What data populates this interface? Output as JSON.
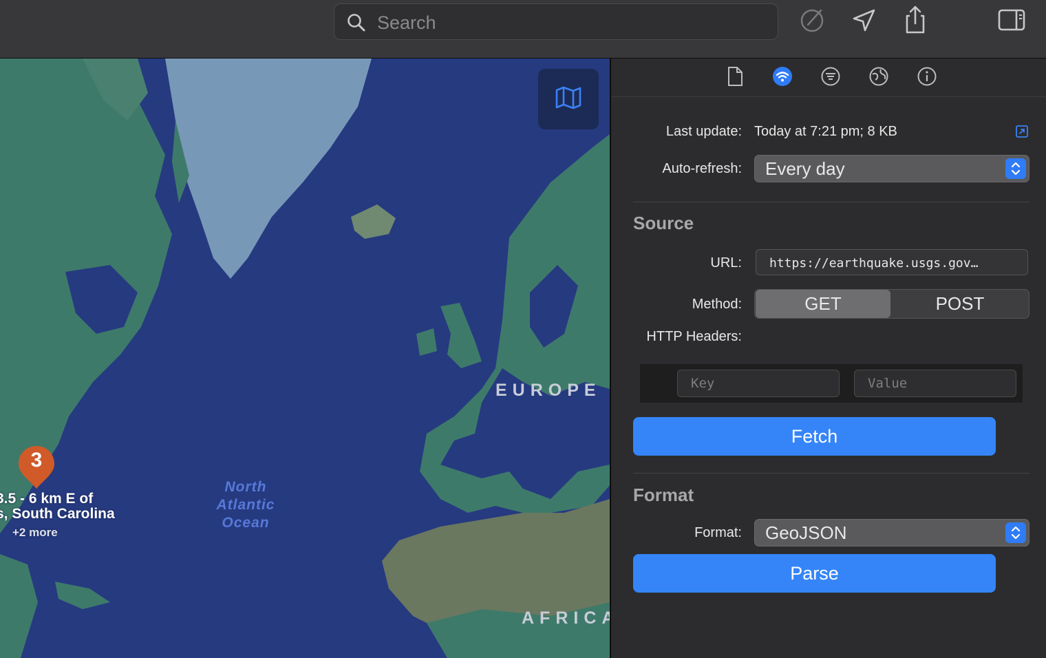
{
  "search": {
    "placeholder": "Search"
  },
  "toolbar": {
    "icons": [
      "check-circle-icon",
      "location-arrow-icon",
      "share-icon",
      "sidebar-icon"
    ]
  },
  "map": {
    "labels": {
      "europe": "EUROPE",
      "africa": "AFRICA"
    },
    "ocean": {
      "line1": "North",
      "line2": "Atlantic",
      "line3": "Ocean"
    },
    "cluster": {
      "count": "3",
      "title_line1": "3.5 - 6 km E of",
      "title_line2": "s, South Carolina",
      "more": "+2 more"
    }
  },
  "inspector": {
    "tabs": [
      "document-icon",
      "feed-icon",
      "filter-icon",
      "globe-icon",
      "info-icon"
    ],
    "active_tab": "feed-icon",
    "last_update_label": "Last update:",
    "last_update_value": "Today at 7:21 pm; 8 KB",
    "auto_refresh_label": "Auto-refresh:",
    "auto_refresh_value": "Every day",
    "source": {
      "title": "Source",
      "url_label": "URL:",
      "url_value": "https://earthquake.usgs.gov…",
      "method_label": "Method:",
      "methods": [
        "GET",
        "POST"
      ],
      "method_selected": "GET",
      "headers_label": "HTTP Headers:",
      "key_placeholder": "Key",
      "value_placeholder": "Value",
      "fetch_label": "Fetch"
    },
    "format": {
      "title": "Format",
      "format_label": "Format:",
      "format_value": "GeoJSON",
      "parse_label": "Parse"
    }
  },
  "colors": {
    "accent": "#3585f8",
    "ocean": "#263a80",
    "land": "#3e7a6a",
    "ice": "#7898b8",
    "desert": "#6b7860",
    "pin": "#d05a28"
  }
}
